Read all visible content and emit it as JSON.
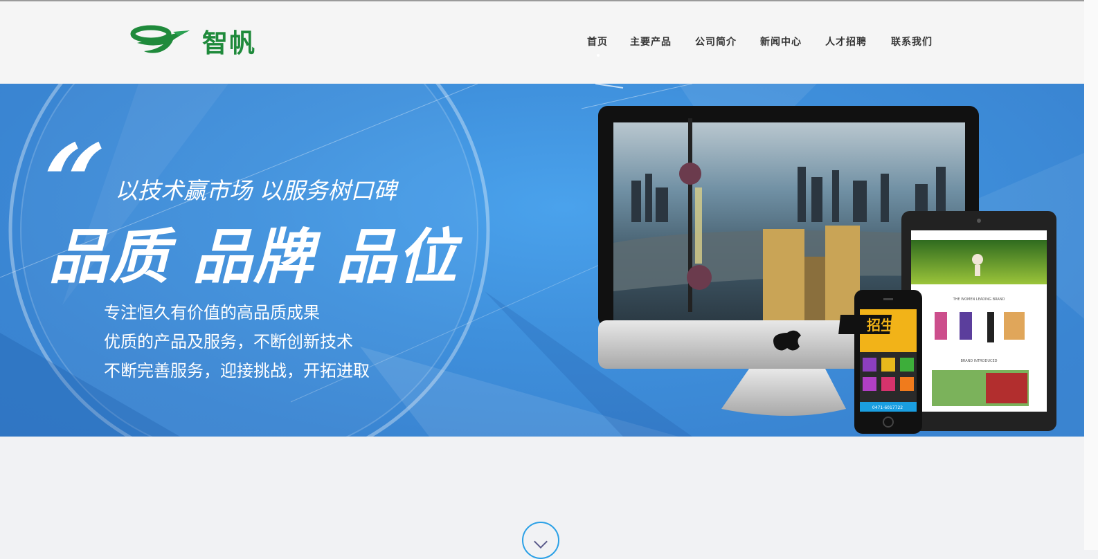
{
  "brand": {
    "name": "智帆",
    "logo_icon": "green-swoosh-logo",
    "color": "#1f8a3b"
  },
  "nav": {
    "items": [
      {
        "label": "首页"
      },
      {
        "label": "主要产品"
      },
      {
        "label": "公司简介"
      },
      {
        "label": "新闻中心"
      },
      {
        "label": "人才招聘"
      },
      {
        "label": "联系我们"
      }
    ]
  },
  "banner": {
    "quote_mark": "“",
    "slogan": "以技术赢市场 以服务树口碑",
    "headline": "品质 品牌 品位",
    "lines": [
      "专注恒久有价值的高品质成果",
      "优质的产品及服务，不断创新技术",
      "不断完善服务，迎接挑战，开拓进取"
    ],
    "background_color": "#3f90dc",
    "phone_screen_title": "招生啦",
    "tablet_screen_texts": [
      "THE WOMEN LEADING BRAND",
      "BRAND INTRODUCED"
    ],
    "phone_screen_footer": "0471-6017722"
  },
  "scroll_button": {
    "icon": "chevron-down-icon",
    "accent_color": "#2aa0e6"
  }
}
